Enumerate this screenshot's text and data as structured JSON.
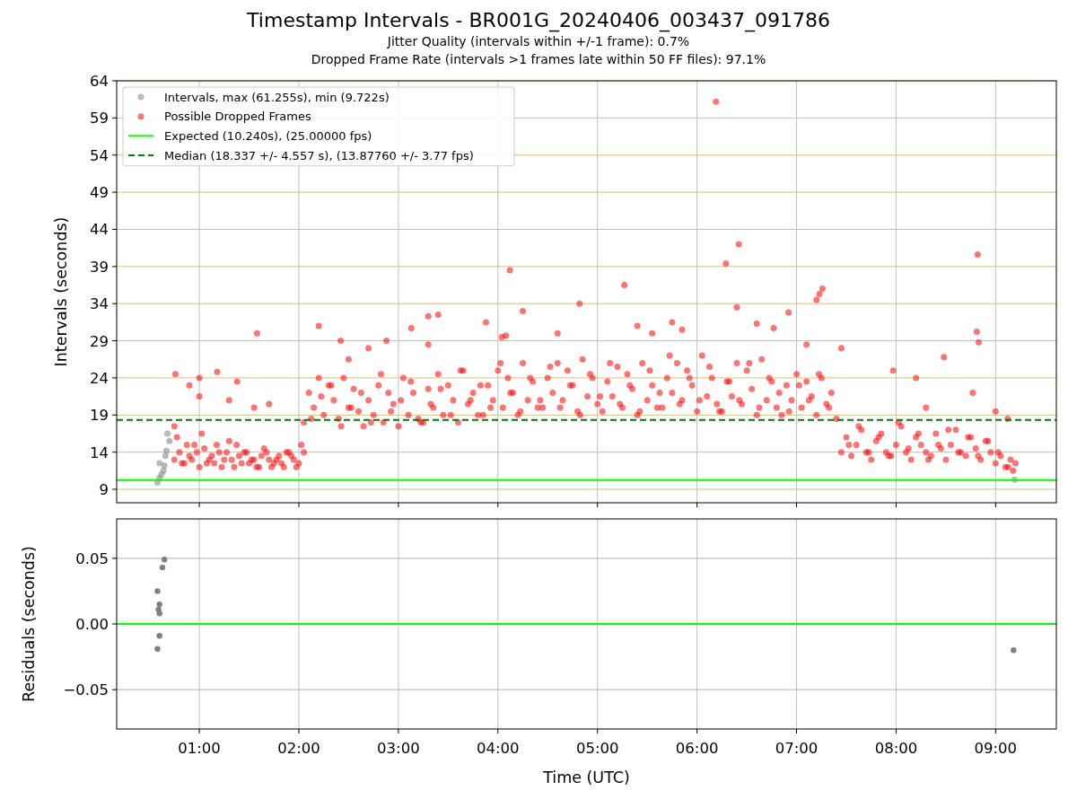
{
  "figure": {
    "title": "Timestamp Intervals - BR001G_20240406_003437_091786",
    "subtitles": [
      "Jitter Quality (intervals within +/-1 frame): 0.7%",
      "Dropped Frame Rate (intervals >1 frames late within 50 FF files): 97.1%"
    ]
  },
  "top_panel": {
    "chart_data": {
      "type": "scatter",
      "ylabel": "Intervals (seconds)",
      "xlim": [
        0.17,
        9.61
      ],
      "ylim": [
        7.19,
        64
      ],
      "grid": true,
      "legend": "upper left",
      "yticks": [
        {
          "value": 9,
          "label": "9"
        },
        {
          "value": 14,
          "label": "14"
        },
        {
          "value": 19,
          "label": "19"
        },
        {
          "value": 24,
          "label": "24"
        },
        {
          "value": 29,
          "label": "29"
        },
        {
          "value": 34,
          "label": "34"
        },
        {
          "value": 39,
          "label": "39"
        },
        {
          "value": 44,
          "label": "44"
        },
        {
          "value": 49,
          "label": "49"
        },
        {
          "value": 54,
          "label": "54"
        },
        {
          "value": 59,
          "label": "59"
        },
        {
          "value": 64,
          "label": "64"
        }
      ],
      "series": [
        {
          "name": "Intervals, max (61.255s), min (9.722s)",
          "color": "#808080",
          "x": [
            0.6,
            0.6,
            0.62,
            0.64,
            0.65,
            0.66,
            0.67,
            0.68,
            0.58,
            0.7,
            9.19
          ],
          "values": [
            10.5,
            12.5,
            11,
            11.5,
            12.2,
            13.5,
            14.2,
            16.5,
            9.9,
            15.5,
            10.3
          ]
        },
        {
          "name": "Possible Dropped Frames",
          "color": "#ff0000",
          "x": [
            0.75,
            0.8,
            0.85,
            0.9,
            0.95,
            1,
            1.05,
            1.1,
            1.15,
            1.2,
            1.25,
            1.3,
            1.35,
            1.4,
            1.45,
            1.5,
            1.55,
            1.6,
            1.65,
            1.7,
            1.75,
            1.8,
            1.85,
            1.9,
            1.95,
            2,
            2.05,
            0.775,
            0.825,
            0.875,
            0.925,
            0.975,
            1.025,
            1.075,
            1.125,
            1.175,
            1.225,
            1.275,
            1.325,
            1.375,
            1.425,
            1.475,
            1.525,
            1.575,
            1.625,
            1.675,
            1.725,
            1.775,
            1.825,
            1.875,
            1.925,
            1.975,
            2.025,
            2.05,
            2.1,
            2.15,
            2.2,
            2.25,
            2.3,
            2.35,
            2.4,
            2.45,
            2.5,
            2.55,
            2.6,
            2.65,
            2.7,
            2.75,
            2.8,
            2.85,
            2.9,
            2.95,
            3,
            3.05,
            3.1,
            3.15,
            3.2,
            3.25,
            3.3,
            3.35,
            3.4,
            3.45,
            3.5,
            3.55,
            3.6,
            3.65,
            3.7,
            3.75,
            3.8,
            3.85,
            3.9,
            3.95,
            4,
            4.05,
            4.1,
            4.15,
            4.2,
            4.25,
            4.3,
            4.35,
            4.4,
            4.45,
            4.5,
            4.55,
            4.6,
            4.65,
            4.7,
            4.75,
            4.8,
            4.85,
            4.9,
            4.95,
            5,
            5.05,
            5.1,
            5.15,
            5.2,
            5.25,
            5.3,
            5.35,
            5.4,
            5.45,
            5.5,
            5.55,
            5.6,
            5.65,
            5.7,
            5.75,
            5.8,
            5.85,
            5.9,
            5.95,
            6,
            6.05,
            6.1,
            6.15,
            6.2,
            6.25,
            6.3,
            6.35,
            6.4,
            6.45,
            6.5,
            6.55,
            6.6,
            6.65,
            6.7,
            6.75,
            6.8,
            6.85,
            6.9,
            6.95,
            7,
            7.05,
            7.1,
            7.15,
            7.2,
            7.25,
            7.3,
            7.35,
            7.4,
            2.125,
            2.225,
            2.325,
            2.425,
            2.525,
            2.625,
            2.725,
            2.825,
            2.925,
            3.025,
            3.125,
            3.225,
            3.325,
            3.425,
            3.525,
            3.625,
            3.725,
            3.825,
            3.925,
            4.025,
            4.125,
            4.225,
            4.325,
            4.425,
            4.525,
            4.625,
            4.725,
            4.825,
            4.925,
            5.025,
            5.125,
            5.225,
            5.325,
            5.425,
            5.525,
            5.625,
            5.725,
            5.825,
            5.925,
            6.025,
            6.125,
            6.225,
            6.325,
            6.425,
            6.525,
            6.625,
            6.725,
            6.825,
            6.925,
            7.025,
            7.125,
            7.225,
            7.325,
            7.45,
            7.5,
            7.55,
            7.6,
            7.65,
            7.7,
            7.75,
            7.8,
            7.85,
            7.9,
            7.95,
            8,
            8.05,
            8.1,
            8.15,
            8.2,
            8.25,
            8.3,
            8.35,
            8.4,
            8.45,
            8.5,
            8.55,
            8.6,
            8.65,
            8.7,
            8.75,
            8.8,
            8.85,
            8.9,
            8.95,
            9,
            9.05,
            9.1,
            9.15,
            9.2,
            7.525,
            7.625,
            7.725,
            7.825,
            7.925,
            8.025,
            8.125,
            8.225,
            8.325,
            8.425,
            8.525,
            8.625,
            8.725,
            8.825,
            8.925,
            9.025,
            9.125,
            9.175,
            0.76,
            0.75,
            0.9,
            1,
            1,
            1.18,
            1.3,
            1.38,
            1.58,
            1.55,
            1.7,
            2.2,
            2.42,
            2.5,
            2.7,
            2.88,
            3.13,
            3.3,
            3.4,
            3.3,
            3.88,
            4.12,
            4.25,
            4.04,
            4.08,
            4.82,
            4.6,
            5.27,
            5.4,
            5.55,
            5.75,
            5.85,
            6.19,
            6.29,
            6.42,
            6.4,
            6.6,
            6.77,
            6.92,
            7.1,
            7.2,
            7.23,
            7.26,
            7.45,
            7.97,
            8.2,
            8.3,
            8.48,
            8.77,
            8.82,
            8.81,
            8.83,
            9,
            9.12
          ],
          "values": [
            13,
            14,
            12.5,
            13.5,
            15,
            12,
            14.5,
            13,
            12.5,
            14,
            13,
            15.5,
            12,
            13.5,
            14,
            12.5,
            13,
            12,
            14.5,
            13,
            12.5,
            13.5,
            12,
            14,
            13,
            12.5,
            14,
            16,
            12.5,
            15,
            13,
            14,
            16.5,
            12.5,
            13.5,
            15,
            12,
            14,
            13,
            15,
            12.5,
            14,
            13,
            12,
            13.5,
            14,
            12,
            13,
            12.5,
            14,
            13.5,
            12,
            15,
            18,
            22,
            20,
            24,
            19,
            23,
            21,
            18.5,
            24,
            20,
            22.5,
            19.5,
            17.5,
            21,
            19,
            23,
            18,
            22,
            20.5,
            17.5,
            24,
            19,
            22,
            18.5,
            18,
            22.5,
            20,
            24.5,
            19,
            23,
            21,
            18,
            25,
            20.5,
            22,
            19,
            19,
            23,
            21,
            25,
            20,
            24,
            22,
            19,
            26,
            21,
            23.5,
            20,
            20,
            24,
            22,
            26,
            21,
            25,
            23,
            19.5,
            26.5,
            21.5,
            24,
            20.5,
            19.5,
            23.5,
            21.5,
            25.5,
            20,
            24.5,
            22.5,
            19,
            26,
            21,
            23,
            20,
            20,
            24,
            22,
            26,
            21,
            25,
            23,
            19.5,
            27,
            21.5,
            24,
            20.5,
            19.5,
            23.5,
            21.5,
            26,
            20.5,
            25,
            22.5,
            19,
            26.5,
            21,
            23.5,
            20,
            19,
            23,
            21,
            24.5,
            20,
            23.5,
            21.5,
            19,
            24,
            20.5,
            22,
            18.5,
            18.5,
            21.5,
            23,
            17.5,
            20,
            22,
            18,
            24.5,
            19.5,
            21,
            23.5,
            18,
            20.5,
            22.5,
            19,
            25,
            21,
            23,
            20,
            26,
            22,
            19.5,
            24,
            21,
            25.5,
            20,
            23,
            19,
            24.5,
            21.5,
            26,
            20.5,
            23,
            19.5,
            25,
            22,
            27,
            20.5,
            24,
            21,
            25.5,
            19.5,
            23.5,
            21,
            26,
            20,
            24,
            22,
            19.5,
            23,
            21,
            24.5,
            20,
            14,
            16,
            13.5,
            15,
            17,
            14,
            13,
            15.5,
            16.5,
            14,
            13.5,
            15,
            17.5,
            14,
            13,
            16,
            15,
            14,
            13.5,
            16.5,
            14.5,
            13,
            15,
            17,
            14,
            13.5,
            16,
            14.5,
            13,
            15.5,
            14,
            12.5,
            13.5,
            12,
            13,
            12.5,
            15,
            17.5,
            14,
            16,
            13.5,
            18,
            14.5,
            16.5,
            13,
            15,
            17,
            14,
            16,
            13.5,
            15.5,
            14,
            12,
            11.5,
            24.5,
            17.5,
            23,
            24,
            21.5,
            24.8,
            21,
            23.5,
            30,
            20,
            20.5,
            31,
            29,
            26.5,
            28,
            29,
            30.7,
            32.3,
            32.5,
            28.5,
            31.5,
            38.5,
            33,
            29.5,
            29.7,
            34,
            30,
            36.5,
            31,
            30,
            31.5,
            30.5,
            61.2,
            39.4,
            42,
            33.5,
            31.3,
            30.7,
            32.8,
            28.5,
            34.5,
            35.3,
            36,
            28,
            25,
            24,
            20,
            26.8,
            22,
            40.6,
            30.2,
            28.8,
            19.5,
            18.5
          ]
        }
      ],
      "ref_lines": [
        {
          "axis": "y",
          "value": 10.24,
          "label": "Expected (10.240s), (25.00000 fps)",
          "color": "#00ff00"
        },
        {
          "axis": "y",
          "value": 18.337,
          "label": "Median (18.337 +/- 4.557 s), (13.87760 +/- 3.77 fps)",
          "color": "#008000"
        }
      ]
    }
  },
  "bottom_panel": {
    "chart_data": {
      "type": "scatter",
      "xlabel": "Time (UTC)",
      "ylabel": "Residuals (seconds)",
      "xlim": [
        0.17,
        9.61
      ],
      "ylim": [
        -0.08,
        0.08
      ],
      "grid": true,
      "xticks": [
        {
          "value": 1,
          "label": "01:00"
        },
        {
          "value": 2,
          "label": "02:00"
        },
        {
          "value": 3,
          "label": "03:00"
        },
        {
          "value": 4,
          "label": "04:00"
        },
        {
          "value": 5,
          "label": "05:00"
        },
        {
          "value": 6,
          "label": "06:00"
        },
        {
          "value": 7,
          "label": "07:00"
        },
        {
          "value": 8,
          "label": "08:00"
        },
        {
          "value": 9,
          "label": "09:00"
        }
      ],
      "yticks": [
        {
          "value": -0.05,
          "label": "−0.05"
        },
        {
          "value": 0,
          "label": "0.00"
        },
        {
          "value": 0.05,
          "label": "0.05"
        }
      ],
      "series": [
        {
          "color": "#808080",
          "x": [
            0.58,
            0.6,
            0.59,
            0.6,
            0.6,
            0.58,
            0.63,
            0.65,
            9.18
          ],
          "values": [
            0.025,
            0.015,
            0.011,
            0.008,
            -0.009,
            -0.019,
            0.043,
            0.049,
            -0.02
          ]
        }
      ],
      "ref_lines": [
        {
          "axis": "y",
          "value": 0,
          "color": "#00ff00"
        }
      ]
    }
  }
}
